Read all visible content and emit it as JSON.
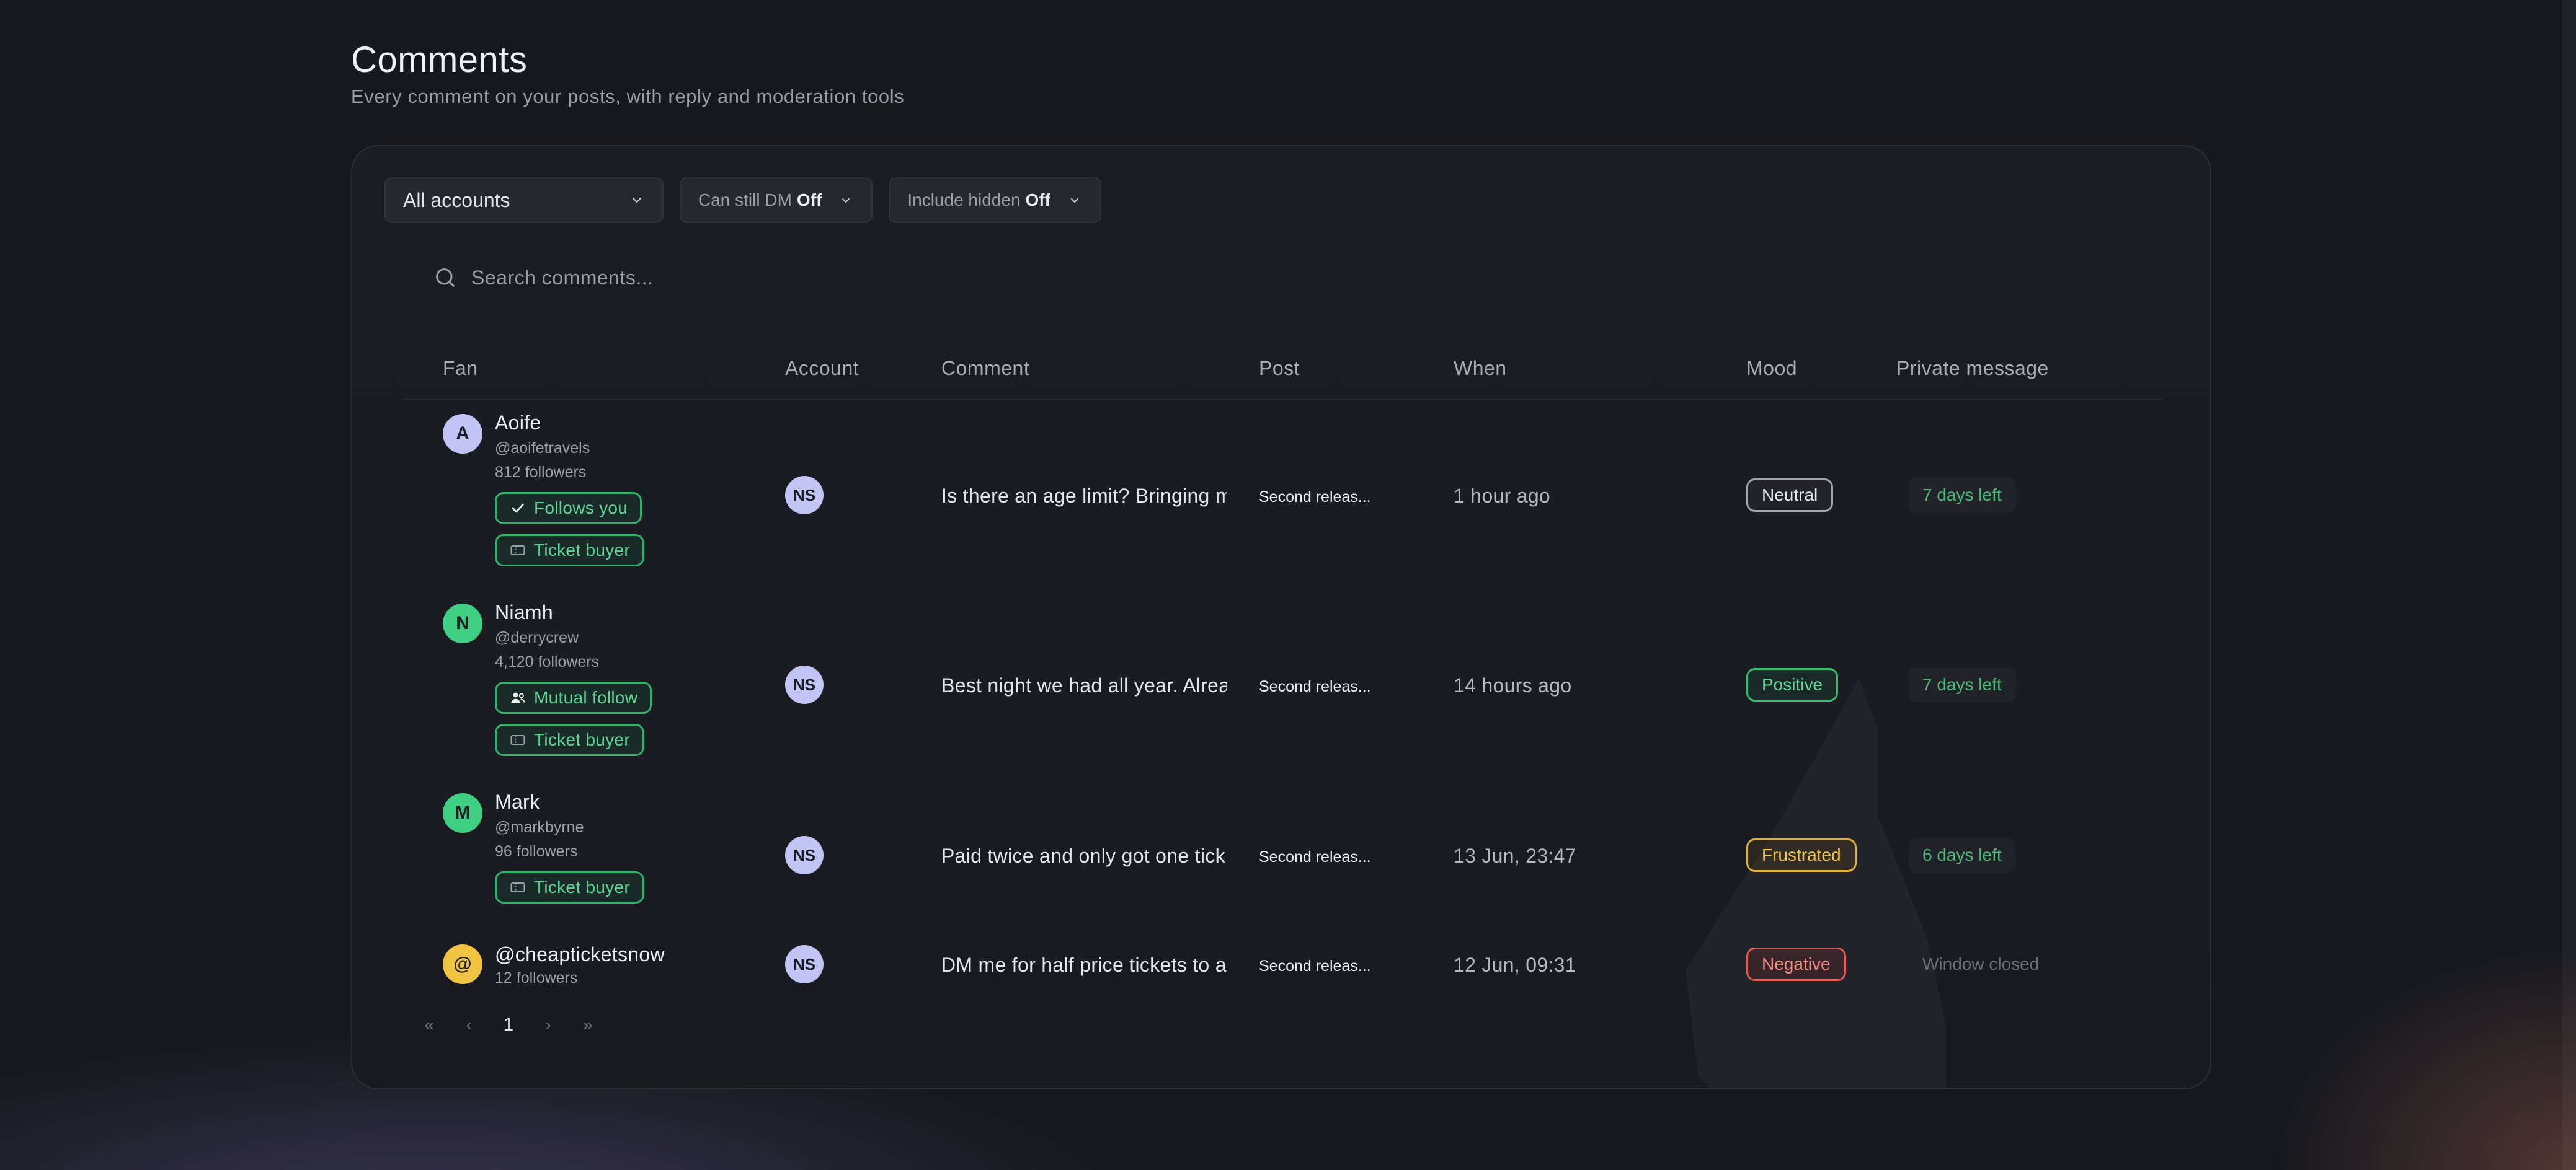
{
  "page": {
    "title": "Comments",
    "subtitle": "Every comment on your posts, with reply and moderation tools"
  },
  "filters": {
    "accounts": {
      "value": "All accounts"
    },
    "can_dm": {
      "label": "Can still DM",
      "value": "Off"
    },
    "include_hidden": {
      "label": "Include hidden",
      "value": "Off"
    }
  },
  "search": {
    "placeholder": "Search comments..."
  },
  "columns": [
    "Fan",
    "Account",
    "Comment",
    "Post",
    "When",
    "Mood",
    "Private message"
  ],
  "rows": [
    {
      "fan": {
        "initial": "A",
        "name": "Aoife",
        "handle": "@aoifetravels",
        "followers": "812 followers",
        "avatar_color": "#c2c5f4",
        "tags": [
          {
            "label": "Follows you",
            "icon": "check-icon"
          },
          {
            "label": "Ticket buyer",
            "icon": "ticket-icon"
          }
        ]
      },
      "account": "NS",
      "comment": "Is there an age limit? Bringing my",
      "post": "Second releas...",
      "when": "1 hour ago",
      "mood": {
        "label": "Neutral",
        "kind": "neutral"
      },
      "pm": {
        "label": "7 days left",
        "state": "open"
      }
    },
    {
      "fan": {
        "initial": "N",
        "name": "Niamh",
        "handle": "@derrycrew",
        "followers": "4,120 followers",
        "avatar_color": "#3fcf82",
        "tags": [
          {
            "label": "Mutual follow",
            "icon": "users-icon"
          },
          {
            "label": "Ticket buyer",
            "icon": "ticket-icon"
          }
        ]
      },
      "account": "NS",
      "comment": "Best night we had all year. Alrea",
      "post": "Second releas...",
      "when": "14 hours ago",
      "mood": {
        "label": "Positive",
        "kind": "positive"
      },
      "pm": {
        "label": "7 days left",
        "state": "open"
      }
    },
    {
      "fan": {
        "initial": "M",
        "name": "Mark",
        "handle": "@markbyrne",
        "followers": "96 followers",
        "avatar_color": "#3fcf82",
        "tags": [
          {
            "label": "Ticket buyer",
            "icon": "ticket-icon"
          }
        ]
      },
      "account": "NS",
      "comment": "Paid twice and only got one tick",
      "post": "Second releas...",
      "when": "13 Jun, 23:47",
      "mood": {
        "label": "Frustrated",
        "kind": "frustrated"
      },
      "pm": {
        "label": "6 days left",
        "state": "open"
      }
    },
    {
      "fan": {
        "initial": "@",
        "name": "@cheapticketsnow",
        "handle": "",
        "followers": "12 followers",
        "avatar_color": "#f0c340",
        "tags": []
      },
      "account": "NS",
      "comment": "DM me for half price tickets to a",
      "post": "Second releas...",
      "when": "12 Jun, 09:31",
      "mood": {
        "label": "Negative",
        "kind": "negative"
      },
      "pm": {
        "label": "Window closed",
        "state": "closed"
      }
    }
  ],
  "pagination": {
    "first": "«",
    "prev": "‹",
    "current": "1",
    "next": "›",
    "last": "»"
  },
  "colors": {
    "accent_green": "#2fb36a",
    "warning": "#e0b030",
    "danger": "#e05b55",
    "background": "#16181e"
  }
}
